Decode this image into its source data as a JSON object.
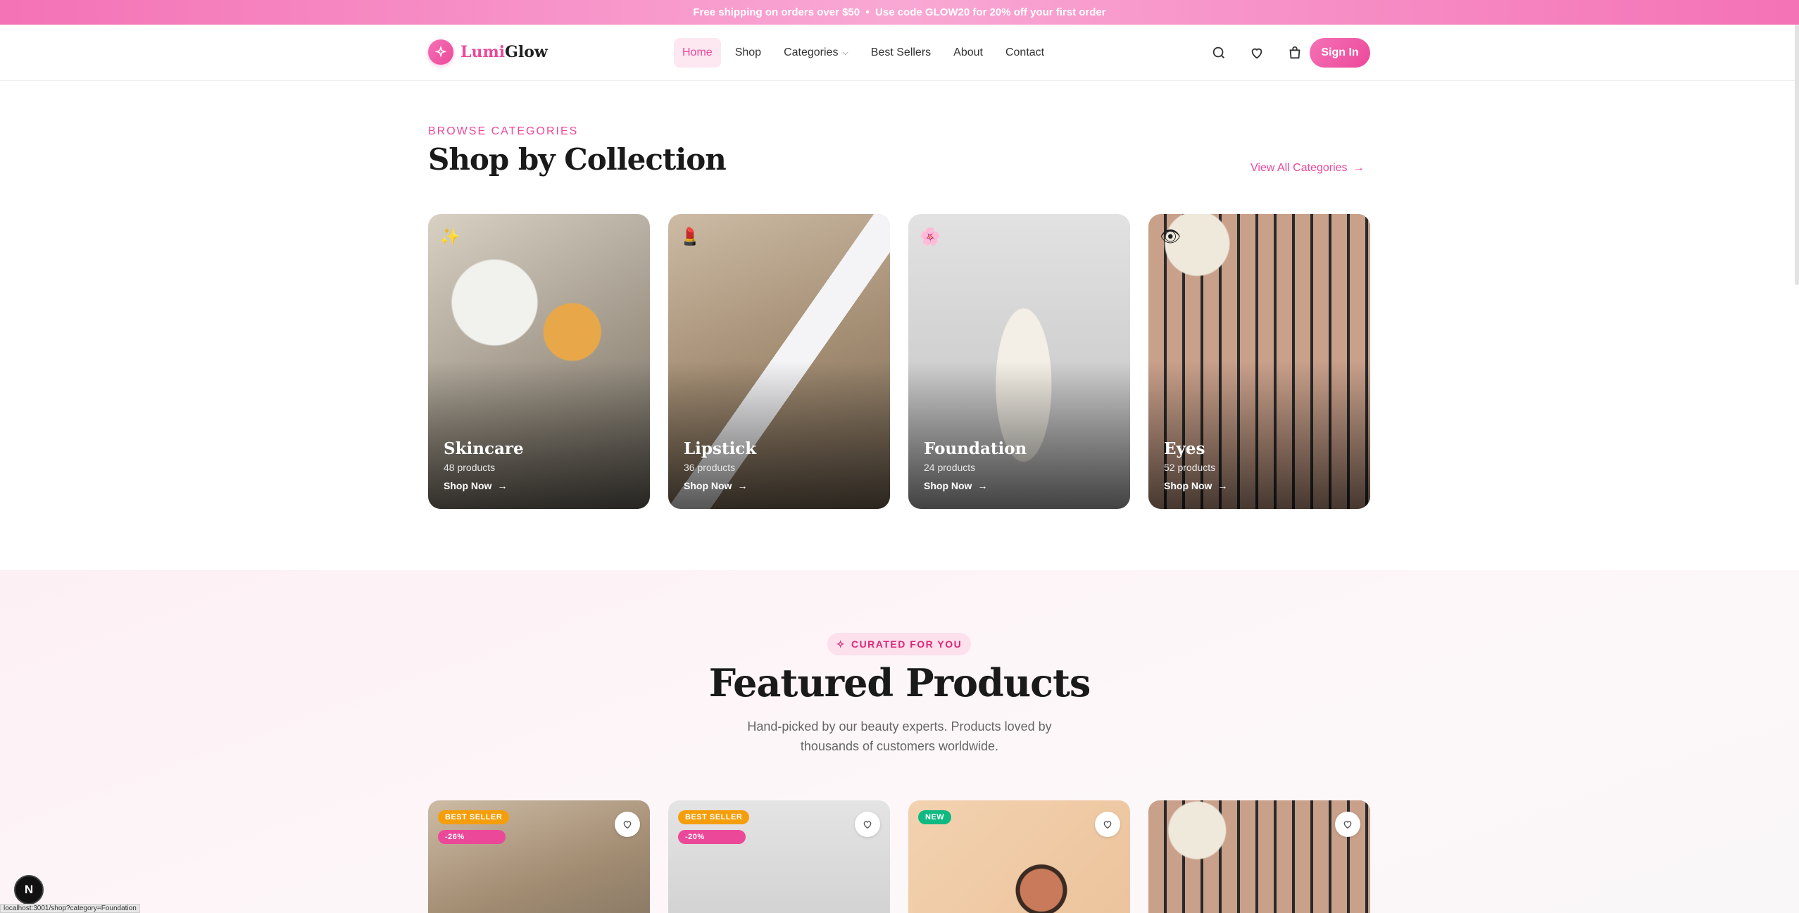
{
  "promo": {
    "text_a": "Free shipping on orders over $50  •  Use code ",
    "code": "GLOW20",
    "text_b": " for 20% off your first order"
  },
  "brand": {
    "name_a": "Lumi",
    "name_b": "Glow",
    "icon": "sparkle-icon",
    "accent": "#ec4899"
  },
  "nav": [
    {
      "label": "Home",
      "active": true
    },
    {
      "label": "Shop"
    },
    {
      "label": "Categories",
      "dropdown": true
    },
    {
      "label": "Best Sellers"
    },
    {
      "label": "About"
    },
    {
      "label": "Contact"
    }
  ],
  "header_icons": [
    "search-icon",
    "heart-icon",
    "cart-icon"
  ],
  "signin_label": "Sign In",
  "categories_section": {
    "eyebrow": "BROWSE CATEGORIES",
    "title": "Shop by Collection",
    "view_all": "View All Categories",
    "items": [
      {
        "emoji": "✨",
        "name": "Skincare",
        "count": "48 products",
        "cta": "Shop Now"
      },
      {
        "emoji": "💄",
        "name": "Lipstick",
        "count": "36 products",
        "cta": "Shop Now"
      },
      {
        "emoji": "🌸",
        "name": "Foundation",
        "count": "24 products",
        "cta": "Shop Now"
      },
      {
        "emoji": "👁",
        "name": "Eyes",
        "count": "52 products",
        "cta": "Shop Now"
      }
    ]
  },
  "featured": {
    "pill": "CURATED FOR YOU",
    "title": "Featured Products",
    "subtitle": "Hand-picked by our beauty experts. Products loved by thousands of customers worldwide.",
    "products": [
      {
        "badge": "BEST SELLER",
        "discount": "-26%"
      },
      {
        "badge": "BEST SELLER",
        "discount": "-20%"
      },
      {
        "badge": "NEW",
        "discount": ""
      },
      {
        "badge": "",
        "discount": ""
      }
    ]
  },
  "status_url": "localhost:3001/shop?category=Foundation",
  "dev_badge": "N"
}
